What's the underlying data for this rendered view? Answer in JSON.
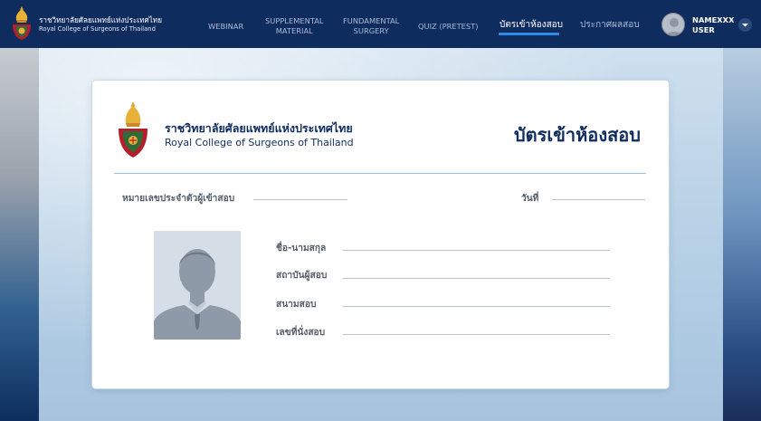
{
  "header": {
    "brand_th": "ราชวิทยาลัยศัลยแพทย์แห่งประเทศไทย",
    "brand_en": "Royal College of Surgeons of Thailand"
  },
  "nav": {
    "webinar": "WEBINAR",
    "supplemental_1": "SUPPLEMENTAL",
    "supplemental_2": "MATERIAL",
    "fundamental_1": "FUNDAMENTAL",
    "fundamental_2": "SURGERY",
    "quiz": "QUIZ (PRETEST)",
    "admission_card": "บัตรเข้าห้องสอบ",
    "results": "ประกาศผลสอบ",
    "active": "admission_card"
  },
  "user": {
    "name": "NAMEXXX",
    "role": "USER",
    "avatar_icon": "user-avatar-icon",
    "menu_icon": "chevron-down-circle-icon"
  },
  "card": {
    "org_th": "ราชวิทยาลัยศัลยแพทย์แห่งประเทศไทย",
    "org_en": "Royal College of Surgeons of Thailand",
    "title": "บัตรเข้าห้องสอบ",
    "candidate_id_label": "หมายเลขประจำตัวผู้เข้าสอบ",
    "date_label": "วันที่",
    "name_label": "ชื่อ-นามสกุล",
    "institution_label": "สถาบันผู้สอบ",
    "venue_label": "สนามสอบ",
    "seat_label": "เลขที่นั่งสอบ",
    "photo_icon": "person-placeholder-icon"
  },
  "colors": {
    "navy": "#0f2c5f",
    "nav_inactive": "#a9bbd6",
    "accent": "#2f8ce6",
    "card_bg": "#ffffff"
  }
}
